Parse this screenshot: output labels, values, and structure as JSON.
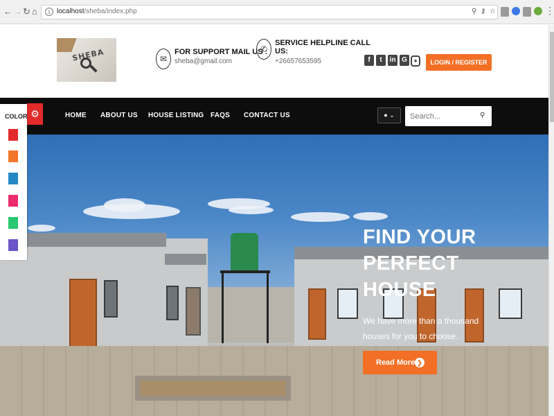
{
  "browser": {
    "url_host": "localhost",
    "url_path": "/sheba/index.php",
    "back_icon": "arrow-left-icon",
    "forward_icon": "arrow-right-icon",
    "reload_icon": "reload-icon",
    "home_icon": "home-icon"
  },
  "header": {
    "logo_text": "SHEBA",
    "support_title": "FOR SUPPORT MAIL US :",
    "support_email": "sheba@gmail.com",
    "helpline_title_line1": "SERVICE HELPLINE CALL",
    "helpline_title_line2": "US:",
    "helpline_phone": "+26657653595",
    "social_icons": [
      "facebook-icon",
      "twitter-icon",
      "linkedin-icon",
      "google-plus-icon",
      "instagram-icon"
    ],
    "login_label": "LOGIN / REGISTER"
  },
  "nav": {
    "items": [
      {
        "label": "HOME"
      },
      {
        "label": "ABOUT US"
      },
      {
        "label": "HOUSE LISTING"
      },
      {
        "label": "FAQS"
      },
      {
        "label": "CONTACT US"
      }
    ],
    "search_placeholder": "Search..."
  },
  "color_panel": {
    "label": "COLOR",
    "swatches": [
      "#e32b2b",
      "#f2762b",
      "#2489c5",
      "#ec2c6e",
      "#27c86f",
      "#6b55c8"
    ]
  },
  "hero": {
    "title_line1": "FIND YOUR",
    "title_line2": "PERFECT",
    "title_line3": "HOUSE",
    "subtitle_line1": "We have more than a thousand",
    "subtitle_line2": "houses for you to choose.",
    "button_label": "Read More"
  },
  "colors": {
    "accent": "#f26f25",
    "navbar": "#0d0d0d"
  }
}
